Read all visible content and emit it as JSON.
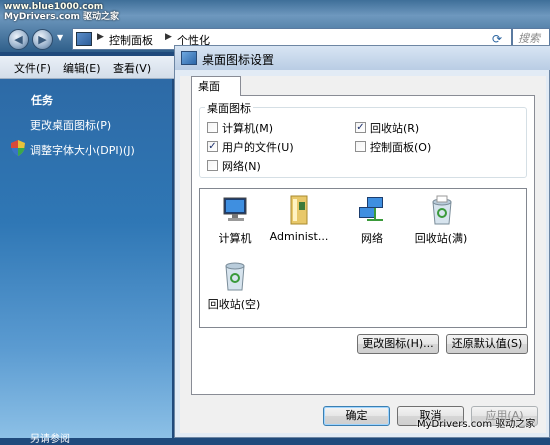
{
  "watermark_top": {
    "line1": "www.blue1000.com",
    "line2": "MyDrivers.com 驱动之家"
  },
  "explorer": {
    "address": {
      "crumb1": "控制面板",
      "crumb2": "个性化"
    },
    "search_placeholder": "搜索",
    "menu": [
      "文件(F)",
      "编辑(E)",
      "查看(V)"
    ],
    "sidebar": {
      "heading": "任务",
      "link1": "更改桌面图标(P)",
      "link2": "调整字体大小(DPI)(J)",
      "bottom_text": "另请参阅"
    }
  },
  "dialog": {
    "title": "桌面图标设置",
    "tab": "桌面",
    "group_label": "桌面图标",
    "checkboxes": [
      {
        "label": "计算机(M)",
        "checked": false
      },
      {
        "label": "回收站(R)",
        "checked": true
      },
      {
        "label": "用户的文件(U)",
        "checked": true
      },
      {
        "label": "控制面板(O)",
        "checked": false
      },
      {
        "label": "网络(N)",
        "checked": false
      }
    ],
    "icons": [
      {
        "caption": "计算机",
        "icon": "computer-icon"
      },
      {
        "caption": "Administ...",
        "icon": "user-folder-icon"
      },
      {
        "caption": "网络",
        "icon": "network-icon"
      },
      {
        "caption": "回收站(满)",
        "icon": "recycle-bin-full-icon"
      },
      {
        "caption": "回收站(空)",
        "icon": "recycle-bin-empty-icon"
      }
    ],
    "buttons": {
      "change_icon": "更改图标(H)...",
      "restore_default": "还原默认值(S)",
      "ok": "确定",
      "cancel": "取消",
      "apply": "应用(A)"
    }
  },
  "watermark_bottom": "MyDrivers.com 驱动之家"
}
